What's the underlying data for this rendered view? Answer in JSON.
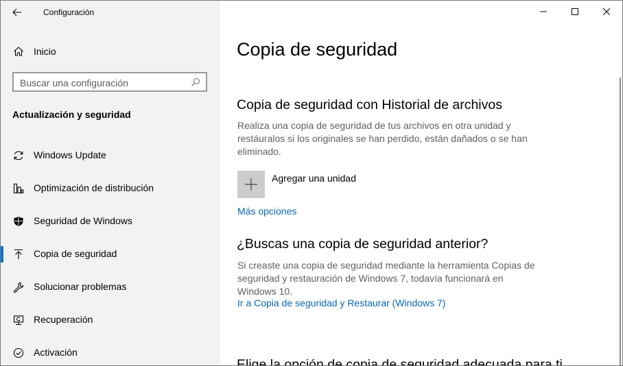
{
  "window": {
    "app_title": "Configuración",
    "controls": [
      "minimize",
      "maximize",
      "close"
    ]
  },
  "sidebar": {
    "home_label": "Inicio",
    "search": {
      "placeholder": "Buscar una configuración"
    },
    "section_title": "Actualización y seguridad",
    "items": [
      {
        "label": "Windows Update",
        "icon": "sync-icon"
      },
      {
        "label": "Optimización de distribución",
        "icon": "delivery-optimization-icon"
      },
      {
        "label": "Seguridad de Windows",
        "icon": "shield-icon"
      },
      {
        "label": "Copia de seguridad",
        "icon": "backup-arrow-icon",
        "active": true
      },
      {
        "label": "Solucionar problemas",
        "icon": "wrench-icon"
      },
      {
        "label": "Recuperación",
        "icon": "recovery-icon"
      },
      {
        "label": "Activación",
        "icon": "check-circle-icon"
      }
    ],
    "accent_color": "#0078d4"
  },
  "main": {
    "page_title": "Copia de seguridad",
    "file_history": {
      "heading": "Copia de seguridad con Historial de archivos",
      "description": "Realiza una copia de seguridad de tus archivos en otra unidad y restáuralos si los originales se han perdido, están dañados o se han eliminado.",
      "add_drive_label": "Agregar una unidad",
      "more_options_link": "Más opciones"
    },
    "older_backup": {
      "heading": "¿Buscas una copia de seguridad anterior?",
      "description": "Si creaste una copia de seguridad mediante la herramienta Copias de seguridad y restauración de Windows 7, todavía funcionará en Windows 10.",
      "restore_link": "Ir a Copia de seguridad y Restaurar (Windows 7)"
    },
    "next_heading_partial": "Elige la opción de copia de seguridad adecuada para ti",
    "link_color": "#0067c0"
  }
}
